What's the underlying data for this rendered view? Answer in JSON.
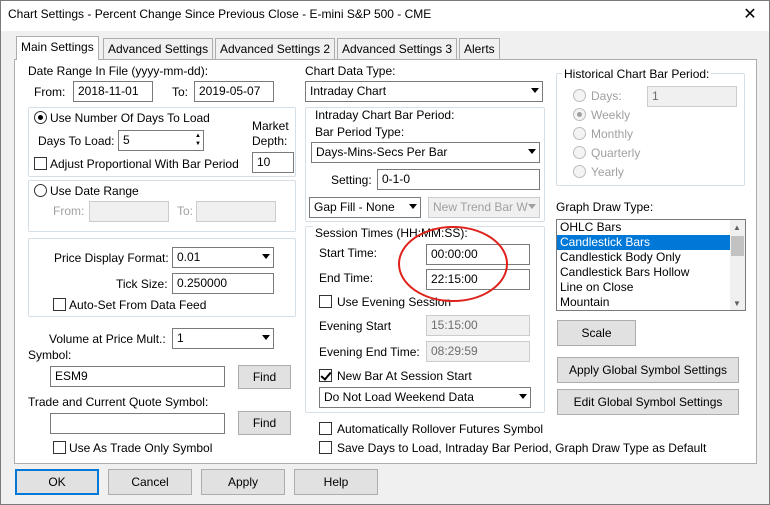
{
  "window": {
    "title": "Chart Settings - Percent Change Since Previous Close - E-mini S&P 500 - CME"
  },
  "tabs": [
    {
      "label": "Main Settings"
    },
    {
      "label": "Advanced Settings"
    },
    {
      "label": "Advanced Settings 2"
    },
    {
      "label": "Advanced Settings 3"
    },
    {
      "label": "Alerts"
    }
  ],
  "date_range": {
    "heading": "Date Range In File (yyyy-mm-dd):",
    "from_label": "From:",
    "from_value": "2018-11-01",
    "to_label": "To:",
    "to_value": "2019-05-07"
  },
  "days_group": {
    "use_days_label": "Use Number Of Days To Load",
    "days_to_load_label": "Days To Load:",
    "days_to_load_value": "5",
    "market_depth_label_1": "Market",
    "market_depth_label_2": "Depth:",
    "market_depth_value": "10",
    "adjust_label": "Adjust Proportional With Bar Period"
  },
  "use_date_range": {
    "label": "Use Date Range",
    "from_label": "From:",
    "to_label": "To:"
  },
  "price": {
    "format_label": "Price Display Format:",
    "format_value": "0.01",
    "tick_label": "Tick Size:",
    "tick_value": "0.250000",
    "autoset_label": "Auto-Set From Data Feed"
  },
  "volume": {
    "label": "Volume at Price Mult.:",
    "value": "1"
  },
  "symbol": {
    "label": "Symbol:",
    "value": "ESM9",
    "find_label": "Find"
  },
  "trade_symbol": {
    "label": "Trade and Current Quote Symbol:",
    "value": "",
    "find_label": "Find",
    "trade_only_label": "Use As Trade Only Symbol"
  },
  "chart_data_type": {
    "label": "Chart Data Type:",
    "value": "Intraday Chart"
  },
  "intraday": {
    "heading": "Intraday Chart Bar Period:",
    "bar_period_type_label": "Bar Period Type:",
    "bar_period_type_value": "Days-Mins-Secs Per Bar",
    "setting_label": "Setting:",
    "setting_value": "0-1-0",
    "gap_fill_value": "Gap Fill - None",
    "new_trend_value": "New Trend Bar W"
  },
  "session": {
    "heading": "Session Times (HH:MM:SS):",
    "start_label": "Start Time:",
    "start_value": "00:00:00",
    "end_label": "End Time:",
    "end_value": "22:15:00",
    "use_evening_label": "Use Evening Session",
    "evening_start_label": "Evening Start",
    "evening_start_value": "15:15:00",
    "evening_end_label": "Evening End Time:",
    "evening_end_value": "08:29:59",
    "new_bar_label": "New Bar At Session Start",
    "weekend_value": "Do Not Load Weekend Data"
  },
  "auto_rollover_label": "Automatically Rollover Futures Symbol",
  "save_default_label": "Save Days to Load, Intraday Bar Period, Graph Draw Type as Default",
  "historical": {
    "heading": "Historical Chart Bar Period:",
    "days_label": "Days:",
    "days_value": "1",
    "options": [
      "Weekly",
      "Monthly",
      "Quarterly",
      "Yearly"
    ]
  },
  "graph_draw": {
    "heading": "Graph Draw Type:",
    "items": [
      "OHLC Bars",
      "Candlestick Bars",
      "Candlestick Body Only",
      "Candlestick Bars Hollow",
      "Line on Close",
      "Mountain"
    ],
    "selected": "Candlestick Bars"
  },
  "buttons": {
    "scale": "Scale",
    "apply_global": "Apply Global Symbol Settings",
    "edit_global": "Edit Global Symbol Settings",
    "ok": "OK",
    "cancel": "Cancel",
    "apply": "Apply",
    "help": "Help"
  },
  "colors": {
    "selection": "#0078d7",
    "annotation_circle": "#e0221c"
  }
}
